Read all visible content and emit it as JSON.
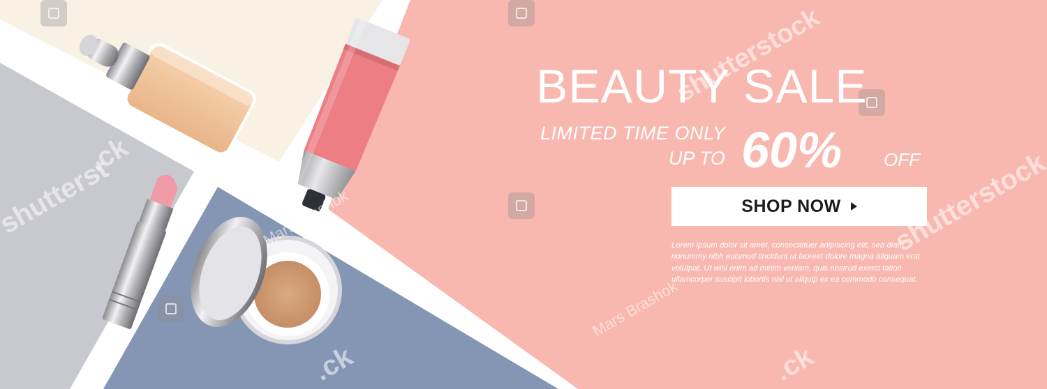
{
  "banner": {
    "headline": "BEAUTY SALE",
    "limited": "LIMITED TIME ONLY",
    "up_to": "UP TO",
    "percent": "60%",
    "off": "OFF",
    "button_label": "SHOP NOW",
    "button_icon": "play-arrow-icon",
    "body_text": "Lorem ipsum dolor sit amet, consectetuer adipiscing elit, sed diam nonummy nibh euismod tincidunt ut laoreet dolore magna aliquam erat volutpat. Ut wisi enim ad minim veniam, quis nostrud exerci tation ullamcorper suscipit lobortis nisl ut aliquip ex ea commodo consequat."
  },
  "watermark": {
    "brand": "shutterstock",
    "brand_fragment": "shutterst",
    "brand_tail": ".ck",
    "author": "Mars Brashok"
  },
  "products": [
    "dropper-bottle",
    "hand-cream-tube",
    "lipstick",
    "cushion-compact"
  ],
  "colors": {
    "pink": "#F8B8AF",
    "cream": "#F9F2E4",
    "gray": "#C8C8CF",
    "blue": "#8496B4",
    "white": "#FFFFFF",
    "button_text": "#1C1C1C"
  }
}
